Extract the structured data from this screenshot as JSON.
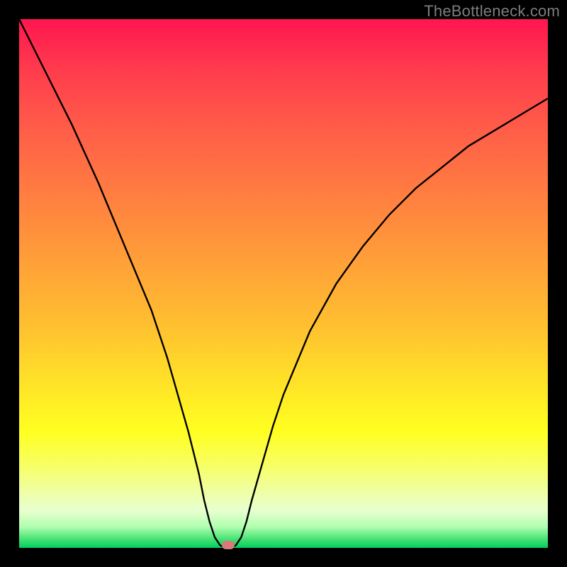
{
  "watermark": "TheBottleneck.com",
  "colors": {
    "frame": "#000000",
    "curve": "#000000",
    "marker": "#d77a7a"
  },
  "chart_data": {
    "type": "line",
    "title": "",
    "xlabel": "",
    "ylabel": "",
    "xlim": [
      0,
      100
    ],
    "ylim": [
      0,
      100
    ],
    "curve": [
      {
        "x": 0,
        "y": 100
      },
      {
        "x": 5,
        "y": 90
      },
      {
        "x": 10,
        "y": 80
      },
      {
        "x": 15,
        "y": 69
      },
      {
        "x": 20,
        "y": 57
      },
      {
        "x": 25,
        "y": 45
      },
      {
        "x": 28,
        "y": 36
      },
      {
        "x": 30,
        "y": 29
      },
      {
        "x": 32,
        "y": 22
      },
      {
        "x": 34,
        "y": 14
      },
      {
        "x": 35,
        "y": 9
      },
      {
        "x": 36,
        "y": 5
      },
      {
        "x": 37,
        "y": 2
      },
      {
        "x": 38,
        "y": 0.5
      },
      {
        "x": 39,
        "y": 0
      },
      {
        "x": 40,
        "y": 0
      },
      {
        "x": 41,
        "y": 0.5
      },
      {
        "x": 42,
        "y": 2
      },
      {
        "x": 43,
        "y": 5
      },
      {
        "x": 44,
        "y": 9
      },
      {
        "x": 46,
        "y": 16
      },
      {
        "x": 48,
        "y": 23
      },
      {
        "x": 50,
        "y": 29
      },
      {
        "x": 55,
        "y": 41
      },
      {
        "x": 60,
        "y": 50
      },
      {
        "x": 65,
        "y": 57
      },
      {
        "x": 70,
        "y": 63
      },
      {
        "x": 75,
        "y": 68
      },
      {
        "x": 80,
        "y": 72
      },
      {
        "x": 85,
        "y": 76
      },
      {
        "x": 90,
        "y": 79
      },
      {
        "x": 95,
        "y": 82
      },
      {
        "x": 100,
        "y": 85
      }
    ],
    "marker": {
      "x": 39.5,
      "y": 0.5
    },
    "gradient_stops": [
      {
        "offset": 0,
        "color": "#ff1650"
      },
      {
        "offset": 0.78,
        "color": "#ffff20"
      },
      {
        "offset": 1.0,
        "color": "#00d060"
      }
    ]
  }
}
